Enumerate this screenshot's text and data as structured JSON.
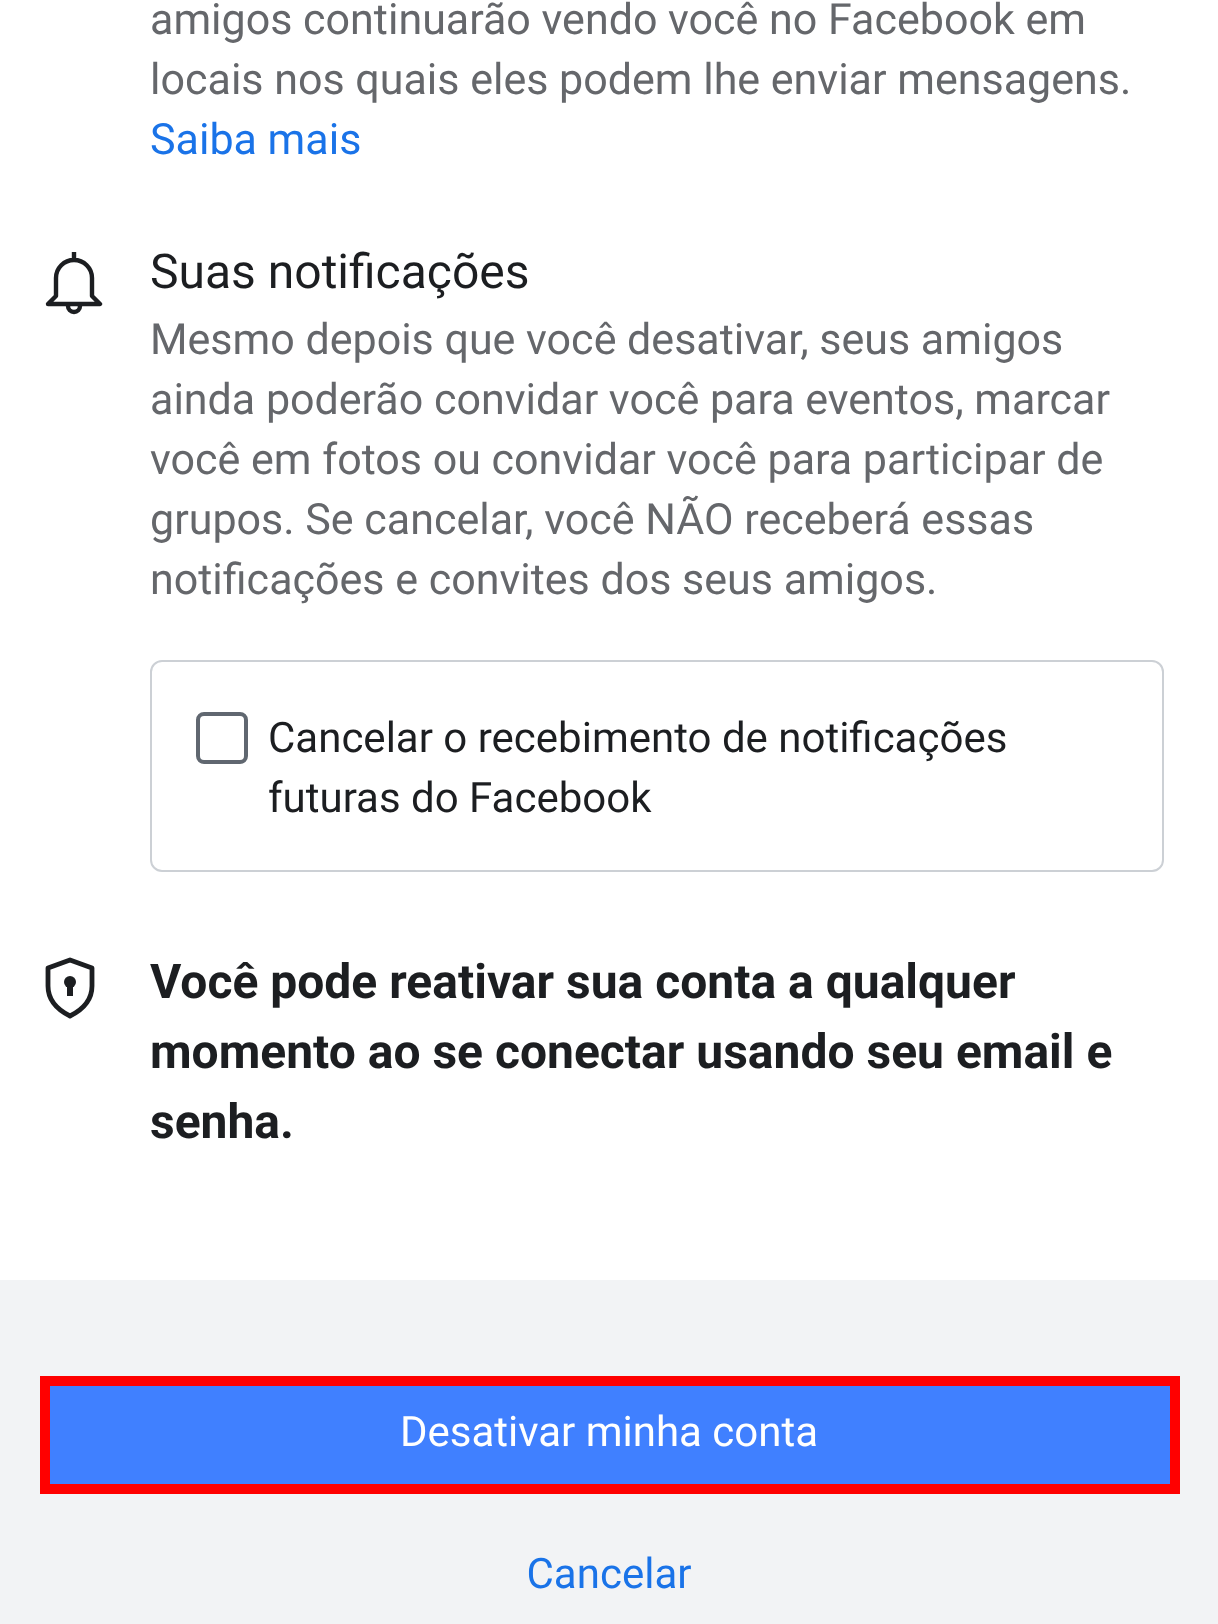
{
  "intro": {
    "text": "amigos continuarão vendo você no Facebook em locais nos quais eles podem lhe enviar mensagens.",
    "link": "Saiba mais"
  },
  "notifications": {
    "title": "Suas notificações",
    "text": "Mesmo depois que você desativar, seus amigos ainda poderão convidar você para eventos, marcar você em fotos ou convidar você para participar de grupos. Se cancelar, você NÃO receberá essas notificações e convites dos seus amigos.",
    "option": {
      "label": "Cancelar o recebimento de notificações futuras do Facebook",
      "checked": false
    }
  },
  "reactivate": {
    "text": "Você pode reativar sua conta a qualquer momento ao se conectar usando seu email e senha."
  },
  "buttons": [
    {
      "label": "Desativar minha conta",
      "kind": "primary",
      "highlighted": true
    },
    {
      "label": "Cancelar",
      "kind": "link",
      "highlighted": false
    }
  ]
}
